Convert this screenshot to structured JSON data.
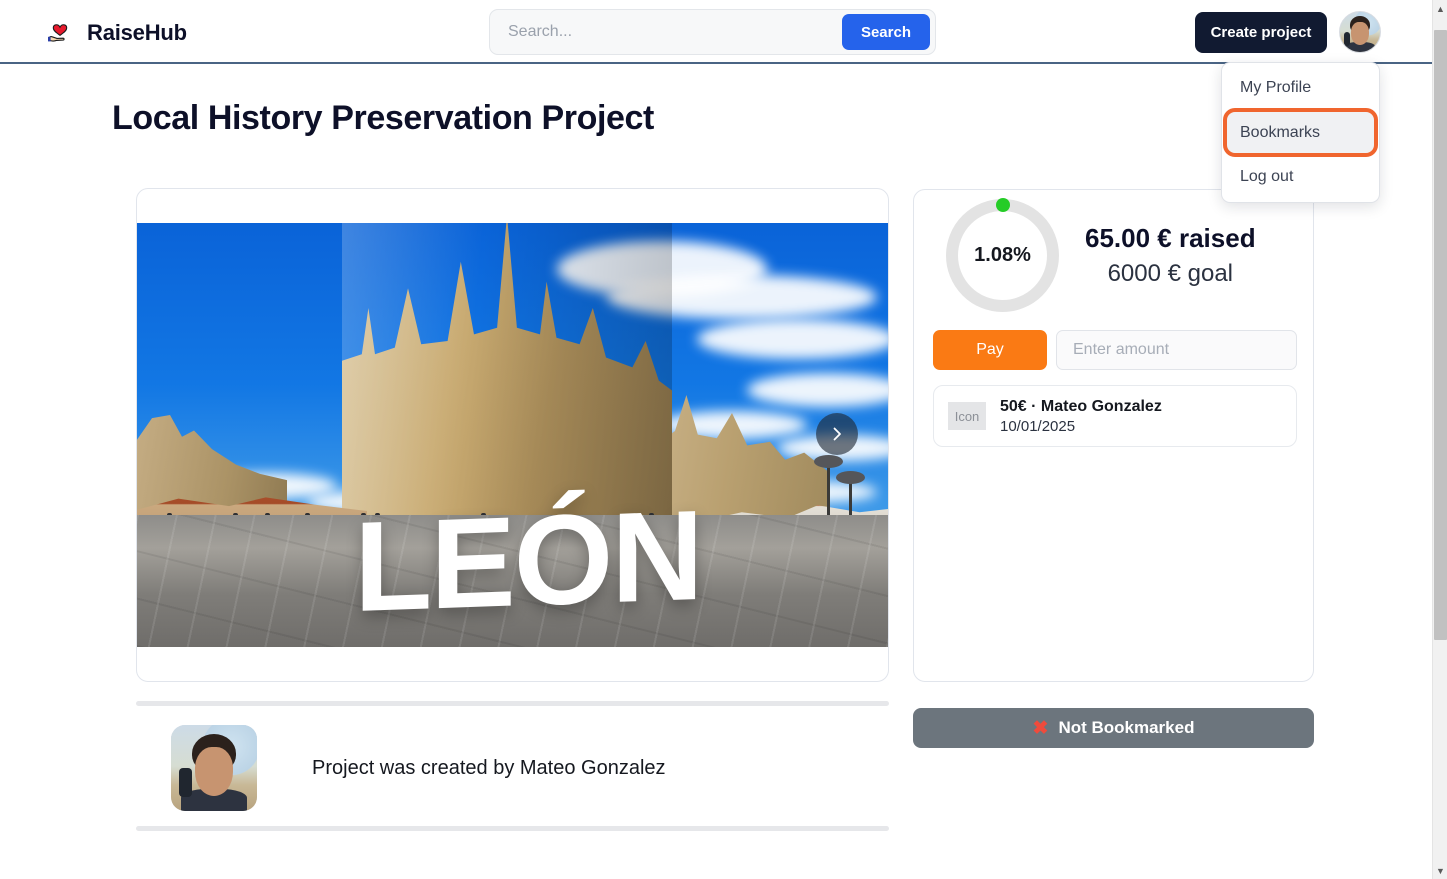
{
  "header": {
    "brand_name": "RaiseHub",
    "brand_logo_icon": "heart-in-hand-icon",
    "search": {
      "placeholder": "Search...",
      "value": "",
      "button_label": "Search"
    },
    "create_project_label": "Create project",
    "avatar_name": "user-avatar"
  },
  "dropdown": {
    "items": [
      {
        "label": "My Profile",
        "highlighted": false
      },
      {
        "label": "Bookmarks",
        "highlighted": true
      },
      {
        "label": "Log out",
        "highlighted": false
      }
    ],
    "highlight_color": "#f0652e",
    "highlight_bg": "#f0f1f3"
  },
  "project": {
    "title": "Local History Preservation Project",
    "image_caption": "LEÓN",
    "image_alt": "Leon Cathedral with large LEON letters in the plaza",
    "carousel_next_icon": "chevron-right-icon",
    "creator_text": "Project was created by Mateo Gonzalez"
  },
  "funding": {
    "percent_label": "1.08%",
    "percent_value": 1.08,
    "raised_label": "65.00 € raised",
    "goal_label": "6000 € goal",
    "raised_amount": 65.0,
    "goal_amount": 6000,
    "currency": "€",
    "ring_track_color": "#e3e3e3",
    "ring_dot_color": "#25cc27",
    "pay_button_label": "Pay",
    "pay_button_color": "#fa7a14",
    "amount_placeholder": "Enter amount",
    "amount_value": "",
    "donations": [
      {
        "icon_label": "Icon",
        "title": "50€ · Mateo Gonzalez",
        "date": "10/01/2025"
      }
    ]
  },
  "bookmark": {
    "label": "Not Bookmarked",
    "icon": "red-cross-mark-icon",
    "button_color": "#6c757d",
    "icon_color": "#ef4b3c"
  },
  "scrollbar": {
    "up_arrow": "▲",
    "down_arrow": "▼"
  }
}
